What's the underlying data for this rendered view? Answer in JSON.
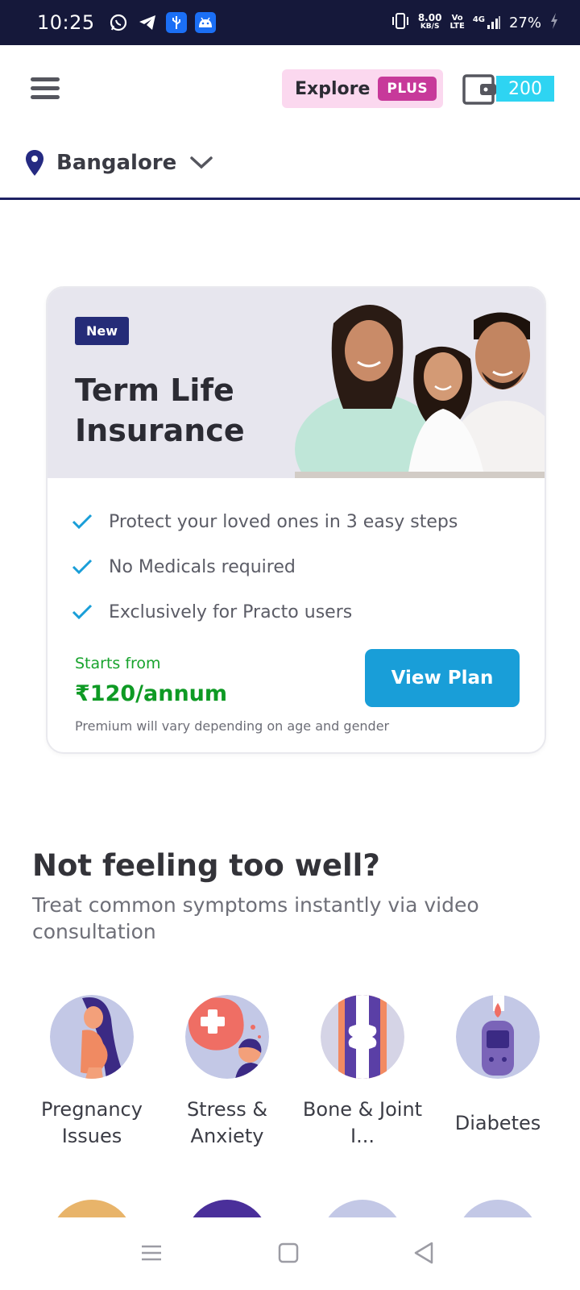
{
  "status_bar": {
    "time": "10:25",
    "network_speed_value": "8.00",
    "network_speed_unit": "KB/S",
    "volte_top": "Vo",
    "volte_bottom": "LTE",
    "signal_label": "4G",
    "battery": "27%",
    "app_icons": [
      "whatsapp-icon",
      "telegram-icon",
      "usb-icon",
      "android-icon"
    ]
  },
  "header": {
    "explore_label": "Explore",
    "plus_label": "PLUS",
    "wallet_count": "200",
    "location": "Bangalore"
  },
  "insurance_card": {
    "badge": "New",
    "title_line1": "Term Life",
    "title_line2": "Insurance",
    "benefits": [
      "Protect your loved ones in 3 easy steps",
      "No Medicals required",
      "Exclusively for Practo users"
    ],
    "starts_from": "Starts from",
    "price": "₹120/annum",
    "cta": "View Plan",
    "note": "Premium will vary depending on age and gender"
  },
  "symptoms_section": {
    "title": "Not feeling too well?",
    "subtitle": "Treat common symptoms instantly via video consultation",
    "items": [
      {
        "label": "Pregnancy Issues",
        "icon": "pregnancy-icon"
      },
      {
        "label": "Stress & Anxiety",
        "icon": "stress-icon"
      },
      {
        "label": "Bone & Joint I...",
        "icon": "bone-joint-icon"
      },
      {
        "label": "Diabetes",
        "icon": "diabetes-icon"
      }
    ]
  },
  "colors": {
    "status_bar_bg": "#15183a",
    "brand_navy": "#1e2263",
    "plus_pink": "#c7399a",
    "cta_blue": "#199ed8",
    "price_green": "#0e9a24"
  }
}
